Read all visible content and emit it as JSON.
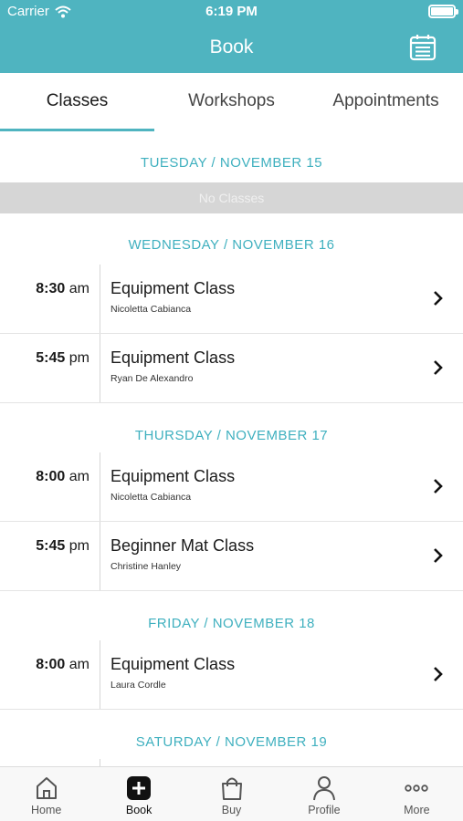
{
  "status_bar": {
    "carrier": "Carrier",
    "time": "6:19 PM"
  },
  "header": {
    "title": "Book"
  },
  "tabs": [
    {
      "label": "Classes",
      "active": true
    },
    {
      "label": "Workshops",
      "active": false
    },
    {
      "label": "Appointments",
      "active": false
    }
  ],
  "schedule": {
    "days": [
      {
        "date": "TUESDAY / NOVEMBER 15",
        "empty_label": "No Classes",
        "classes": []
      },
      {
        "date": "WEDNESDAY / NOVEMBER 16",
        "classes": [
          {
            "time": "8:30",
            "ampm": "am",
            "name": "Equipment Class",
            "instructor": "Nicoletta Cabianca"
          },
          {
            "time": "5:45",
            "ampm": "pm",
            "name": "Equipment Class",
            "instructor": "Ryan De Alexandro"
          }
        ]
      },
      {
        "date": "THURSDAY / NOVEMBER 17",
        "classes": [
          {
            "time": "8:00",
            "ampm": "am",
            "name": "Equipment Class",
            "instructor": "Nicoletta Cabianca"
          },
          {
            "time": "5:45",
            "ampm": "pm",
            "name": "Beginner Mat Class",
            "instructor": "Christine Hanley"
          }
        ]
      },
      {
        "date": "FRIDAY / NOVEMBER 18",
        "classes": [
          {
            "time": "8:00",
            "ampm": "am",
            "name": "Equipment Class",
            "instructor": "Laura Cordle"
          }
        ]
      },
      {
        "date": "SATURDAY / NOVEMBER 19",
        "classes": []
      }
    ]
  },
  "bottom_nav": [
    {
      "label": "Home",
      "icon": "home-icon"
    },
    {
      "label": "Book",
      "icon": "plus-square-icon",
      "active": true
    },
    {
      "label": "Buy",
      "icon": "bag-icon"
    },
    {
      "label": "Profile",
      "icon": "person-icon"
    },
    {
      "label": "More",
      "icon": "more-icon"
    }
  ],
  "colors": {
    "accent": "#4fb4c0",
    "date_text": "#3fb0bf"
  }
}
